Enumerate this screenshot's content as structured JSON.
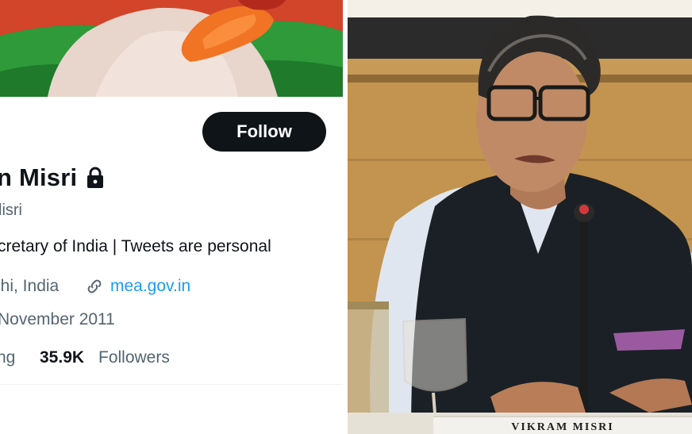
{
  "profile": {
    "follow_label": "Follow",
    "display_name": "n Misri",
    "handle": "lisri",
    "bio": "cretary of India | Tweets are personal",
    "location": "lhi, India",
    "website": "mea.gov.in",
    "joined": "November 2011",
    "following_label": "ng",
    "followers_count": "35.9K",
    "followers_label": "Followers",
    "icons": {
      "lock": "lock-icon",
      "link": "link-icon"
    }
  },
  "photo": {
    "nameplate": "VIKRAM MISRI"
  },
  "colors": {
    "text_primary": "#0f1419",
    "text_secondary": "#536471",
    "link": "#1d9bf0",
    "button_bg": "#0f1419"
  }
}
